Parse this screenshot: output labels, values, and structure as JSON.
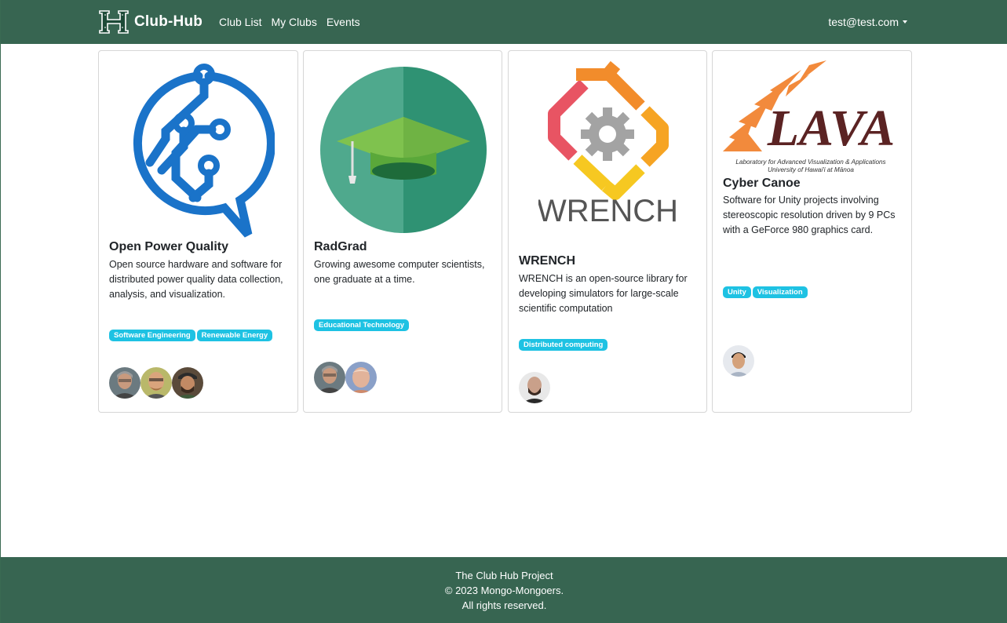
{
  "navbar": {
    "brand": "Club-Hub",
    "links": [
      "Club List",
      "My Clubs",
      "Events"
    ],
    "user": "test@test.com"
  },
  "cards": [
    {
      "title": "Open Power Quality",
      "description": "Open source hardware and software for distributed power quality data collection, analysis, and visualization.",
      "tags": [
        "Software Engineering",
        "Renewable Energy"
      ],
      "logo": "chat-circuit-logo"
    },
    {
      "title": "RadGrad",
      "description": "Growing awesome computer scientists, one graduate at a time.",
      "tags": [
        "Educational Technology"
      ],
      "logo": "graduation-cap-logo"
    },
    {
      "title": "WRENCH",
      "description": "WRENCH is an open-source library for developing simulators for large-scale scientific computation",
      "tags": [
        "Distributed computing"
      ],
      "logo": "wrench-gear-logo",
      "logo_text": "WRENCH"
    },
    {
      "title": "Cyber Canoe",
      "description": "Software for Unity projects involving stereoscopic resolution driven by 9 PCs with a GeForce 980 graphics card.",
      "tags": [
        "Unity",
        "Visualization"
      ],
      "logo": "lava-logo",
      "logo_text": "LAVA",
      "logo_subtext_1": "Laboratory for Advanced Visualization & Applications",
      "logo_subtext_2": "University of Hawai'i at Mānoa"
    }
  ],
  "footer": {
    "line1": "The Club Hub Project",
    "line2": "© 2023 Mongo-Mongoers.",
    "line3": "All rights reserved."
  },
  "colors": {
    "navbar": "#376551",
    "tag": "#1ec2e3"
  }
}
